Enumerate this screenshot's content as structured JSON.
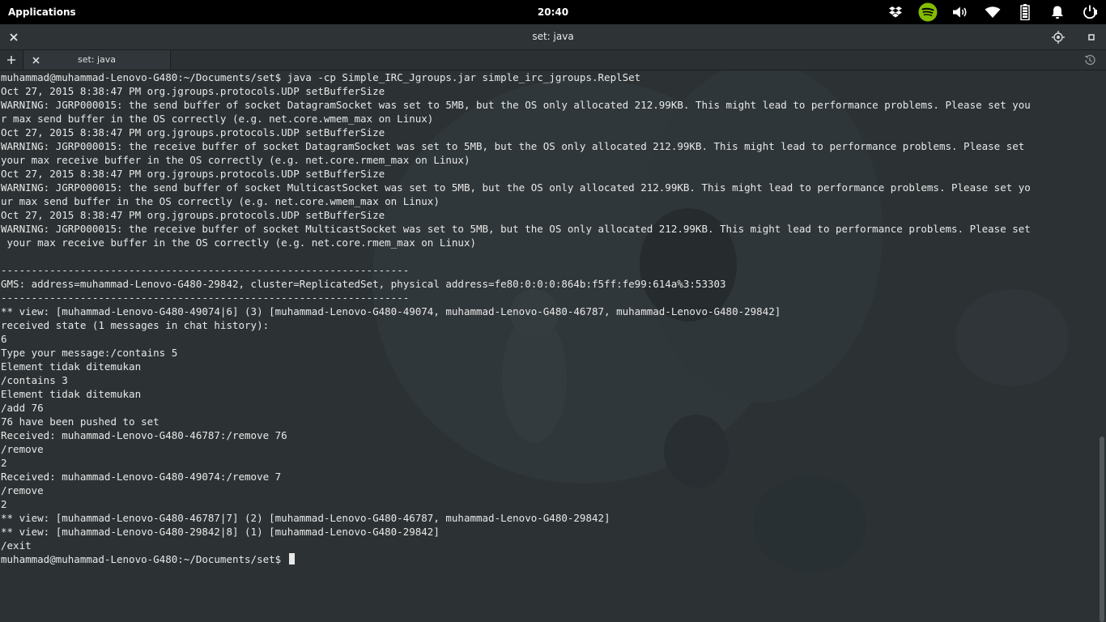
{
  "panel": {
    "applications_label": "Applications",
    "clock": "20:40",
    "tray_icons": [
      "dropbox-icon",
      "spotify-icon",
      "volume-icon",
      "wifi-icon",
      "battery-icon",
      "notifications-icon",
      "power-icon"
    ]
  },
  "window": {
    "title": "set: java"
  },
  "tabs": [
    {
      "label": "set: java"
    }
  ],
  "colors": {
    "panel_bg": "#000000",
    "titlebar_bg": "#2e3436",
    "terminal_bg": "#2c3234",
    "terminal_fg": "#e8e8e8",
    "spotify_green": "#84bd00"
  },
  "terminal": {
    "lines": [
      "muhammad@muhammad-Lenovo-G480:~/Documents/set$ java -cp Simple_IRC_Jgroups.jar simple_irc_jgroups.ReplSet",
      "Oct 27, 2015 8:38:47 PM org.jgroups.protocols.UDP setBufferSize",
      "WARNING: JGRP000015: the send buffer of socket DatagramSocket was set to 5MB, but the OS only allocated 212.99KB. This might lead to performance problems. Please set you",
      "r max send buffer in the OS correctly (e.g. net.core.wmem_max on Linux)",
      "Oct 27, 2015 8:38:47 PM org.jgroups.protocols.UDP setBufferSize",
      "WARNING: JGRP000015: the receive buffer of socket DatagramSocket was set to 5MB, but the OS only allocated 212.99KB. This might lead to performance problems. Please set",
      "your max receive buffer in the OS correctly (e.g. net.core.rmem_max on Linux)",
      "Oct 27, 2015 8:38:47 PM org.jgroups.protocols.UDP setBufferSize",
      "WARNING: JGRP000015: the send buffer of socket MulticastSocket was set to 5MB, but the OS only allocated 212.99KB. This might lead to performance problems. Please set yo",
      "ur max send buffer in the OS correctly (e.g. net.core.wmem_max on Linux)",
      "Oct 27, 2015 8:38:47 PM org.jgroups.protocols.UDP setBufferSize",
      "WARNING: JGRP000015: the receive buffer of socket MulticastSocket was set to 5MB, but the OS only allocated 212.99KB. This might lead to performance problems. Please set",
      " your max receive buffer in the OS correctly (e.g. net.core.rmem_max on Linux)",
      "",
      "-------------------------------------------------------------------",
      "GMS: address=muhammad-Lenovo-G480-29842, cluster=ReplicatedSet, physical address=fe80:0:0:0:864b:f5ff:fe99:614a%3:53303",
      "-------------------------------------------------------------------",
      "** view: [muhammad-Lenovo-G480-49074|6] (3) [muhammad-Lenovo-G480-49074, muhammad-Lenovo-G480-46787, muhammad-Lenovo-G480-29842]",
      "received state (1 messages in chat history):",
      "6",
      "Type your message:/contains 5",
      "Element tidak ditemukan",
      "/contains 3",
      "Element tidak ditemukan",
      "/add 76",
      "76 have been pushed to set",
      "Received: muhammad-Lenovo-G480-46787:/remove 76",
      "/remove",
      "2",
      "Received: muhammad-Lenovo-G480-49074:/remove 7",
      "/remove",
      "2",
      "** view: [muhammad-Lenovo-G480-46787|7] (2) [muhammad-Lenovo-G480-46787, muhammad-Lenovo-G480-29842]",
      "** view: [muhammad-Lenovo-G480-29842|8] (1) [muhammad-Lenovo-G480-29842]",
      "/exit"
    ],
    "prompt": "muhammad@muhammad-Lenovo-G480:~/Documents/set$"
  }
}
